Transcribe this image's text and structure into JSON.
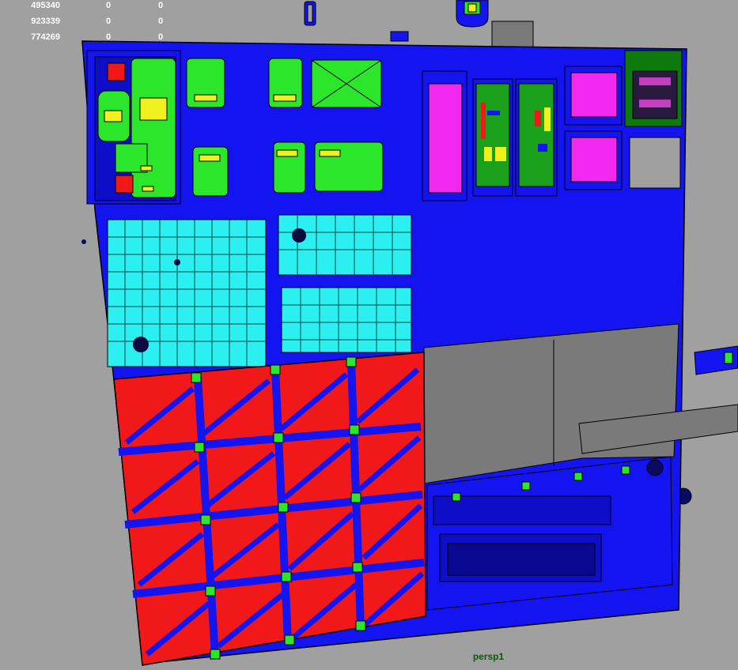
{
  "hud": {
    "rows": [
      [
        "495340",
        "0",
        "0"
      ],
      [
        "923339",
        "0",
        "0"
      ],
      [
        "774269",
        "0",
        "0"
      ]
    ]
  },
  "viewport": {
    "camera_label": "persp1",
    "colors": {
      "background": "#a0a0a0",
      "panel_blue": "#1414f0",
      "panel_green": "#2ce62c",
      "panel_cyan": "#2cf0f0",
      "panel_red": "#f01818",
      "panel_magenta": "#f028f0",
      "panel_gray": "#7a7a7a",
      "panel_yellow": "#f0f01e",
      "camera_label_color": "#0b5a0b"
    }
  }
}
